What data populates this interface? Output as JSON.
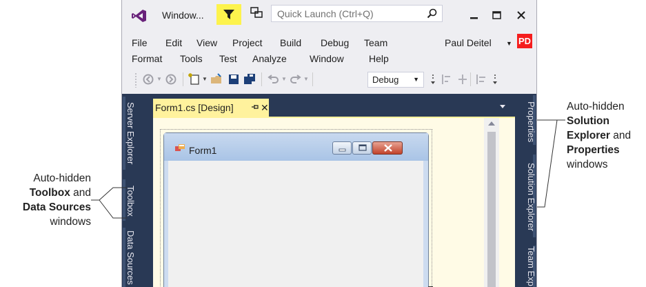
{
  "window": {
    "title": "Window...",
    "quick_launch_placeholder": "Quick Launch (Ctrl+Q)"
  },
  "menu": {
    "row1": [
      "File",
      "Edit",
      "View",
      "Project",
      "Build",
      "Debug",
      "Team"
    ],
    "row2": [
      "Format",
      "Tools",
      "Test",
      "Analyze",
      "Window",
      "Help"
    ]
  },
  "user": {
    "name": "Paul Deitel",
    "initials": "PD",
    "avatar_color": "#f51d1d"
  },
  "toolbar": {
    "configuration": "Debug"
  },
  "left_dock": {
    "tabs": [
      "Server Explorer",
      "Toolbox",
      "Data Sources"
    ]
  },
  "right_dock": {
    "tabs": [
      "Properties",
      "Solution Explorer",
      "Team Exp"
    ]
  },
  "document_tab": {
    "label": "Form1.cs [Design]",
    "close_glyph": "✕",
    "highlight_color": "#fff29d"
  },
  "form": {
    "title": "Form1"
  },
  "callouts": {
    "left": {
      "line1": "Auto-hidden",
      "bold1": "Toolbox",
      "and": " and",
      "bold2": "Data Sources",
      "line4": "windows"
    },
    "right": {
      "line1": "Auto-hidden",
      "bold1": "Solution",
      "bold2": "Explorer",
      "and": " and",
      "bold3": "Properties",
      "line5": "windows"
    }
  },
  "colors": {
    "dock_background": "#293955",
    "filter_yellow": "#fdf34d"
  }
}
